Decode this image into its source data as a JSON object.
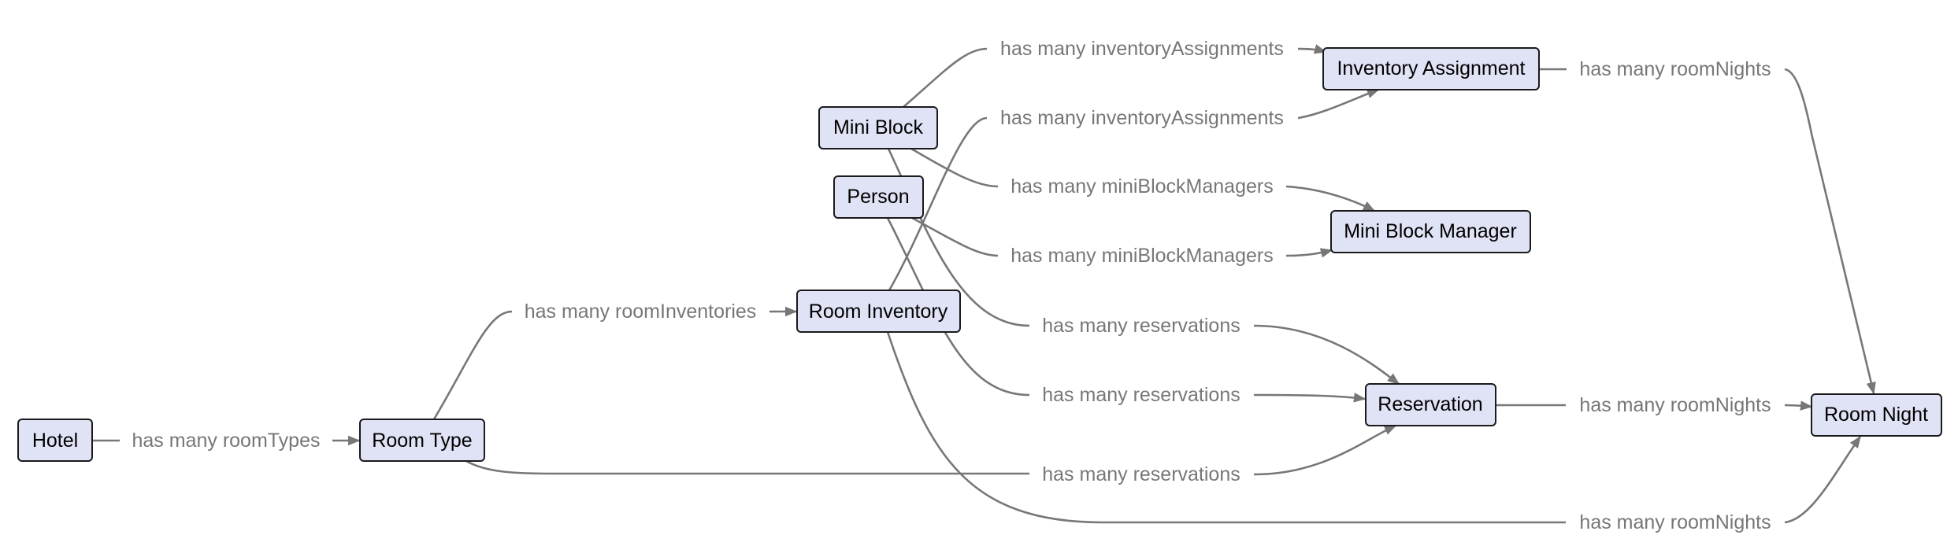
{
  "diagram": {
    "type": "entity-relationship-flow",
    "colors": {
      "node_fill": "#e0e2f5",
      "node_border": "#1a1a1a",
      "edge": "#777777",
      "label_text": "#777777",
      "node_text": "#000000"
    },
    "nodes": [
      {
        "id": "hotel",
        "label": "Hotel"
      },
      {
        "id": "room_type",
        "label": "Room Type"
      },
      {
        "id": "room_inventory",
        "label": "Room Inventory"
      },
      {
        "id": "mini_block",
        "label": "Mini Block"
      },
      {
        "id": "person",
        "label": "Person"
      },
      {
        "id": "inventory_assignment",
        "label": "Inventory Assignment"
      },
      {
        "id": "mini_block_manager",
        "label": "Mini Block Manager"
      },
      {
        "id": "reservation",
        "label": "Reservation"
      },
      {
        "id": "room_night",
        "label": "Room Night"
      }
    ],
    "edges": [
      {
        "from": "hotel",
        "to": "room_type",
        "label": "has many roomTypes"
      },
      {
        "from": "room_type",
        "to": "room_inventory",
        "label": "has many roomInventories"
      },
      {
        "from": "mini_block",
        "to": "inventory_assignment",
        "label": "has many inventoryAssignments"
      },
      {
        "from": "room_inventory",
        "to": "inventory_assignment",
        "label": "has many inventoryAssignments"
      },
      {
        "from": "mini_block",
        "to": "mini_block_manager",
        "label": "has many miniBlockManagers"
      },
      {
        "from": "person",
        "to": "mini_block_manager",
        "label": "has many miniBlockManagers"
      },
      {
        "from": "mini_block",
        "to": "reservation",
        "label": "has many reservations"
      },
      {
        "from": "person",
        "to": "reservation",
        "label": "has many reservations"
      },
      {
        "from": "room_type",
        "to": "reservation",
        "label": "has many reservations"
      },
      {
        "from": "inventory_assignment",
        "to": "room_night",
        "label": "has many roomNights"
      },
      {
        "from": "reservation",
        "to": "room_night",
        "label": "has many roomNights"
      },
      {
        "from": "room_inventory",
        "to": "room_night",
        "label": "has many roomNights"
      }
    ]
  }
}
